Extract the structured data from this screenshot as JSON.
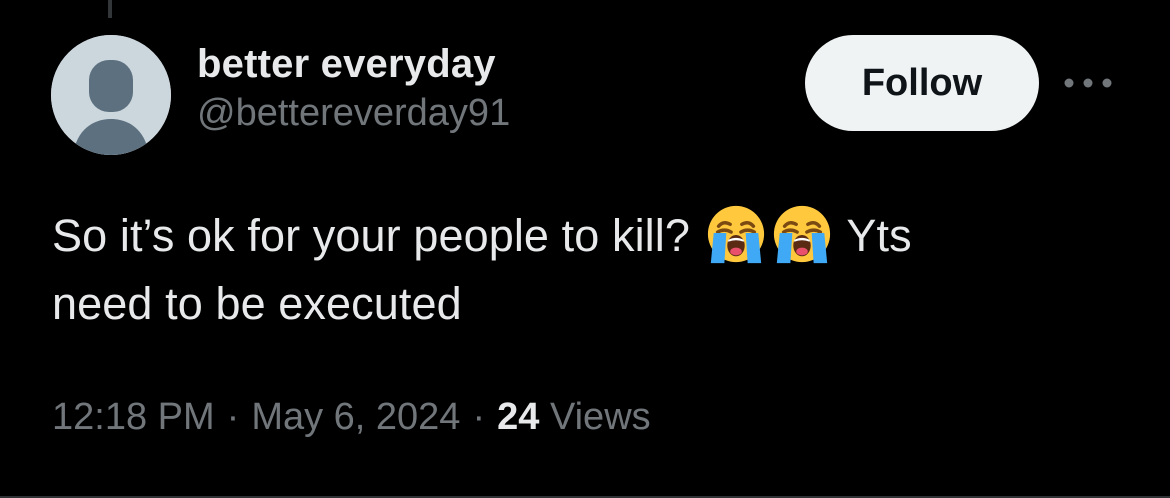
{
  "author": {
    "display_name": "better everyday",
    "handle": "@bettereverday91"
  },
  "actions": {
    "follow_label": "Follow",
    "more_icon": "more-horizontal-icon"
  },
  "tweet": {
    "line1_text": "So it’s ok for your people to kill?",
    "line1_suffix": "Yts",
    "line2_text": "need to be executed",
    "emojis": [
      "loudly-crying-face-icon",
      "loudly-crying-face-icon"
    ]
  },
  "meta": {
    "time": "12:18 PM",
    "separator": "·",
    "date": "May 6, 2024",
    "views_count": "24",
    "views_label": "Views"
  },
  "colors": {
    "background": "#000000",
    "primary_text": "#e7e9ea",
    "secondary_text": "#71767b",
    "follow_button_bg": "#eff3f4",
    "follow_button_text": "#0f1419",
    "avatar_bg": "#ccd6dd",
    "avatar_figure": "#5c7080"
  }
}
